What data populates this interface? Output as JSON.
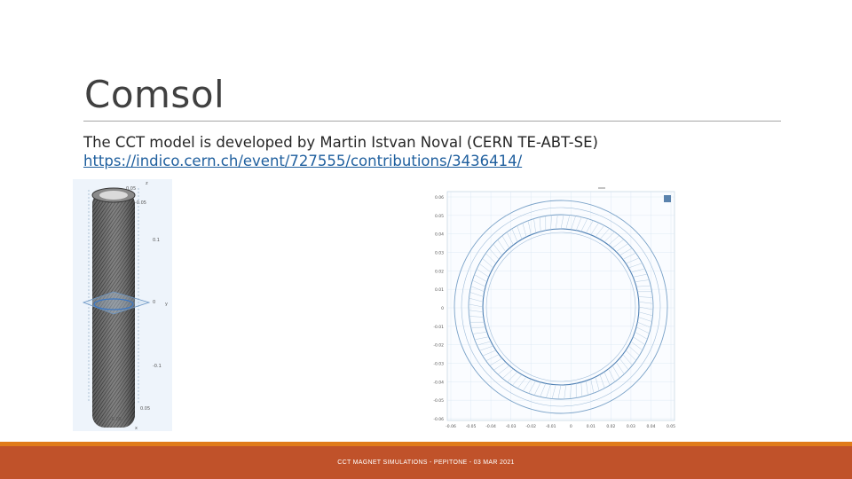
{
  "slide": {
    "title": "Comsol",
    "line1": "The CCT model is developed by Martin Istvan Noval (CERN TE-ABT-SE)",
    "link": "https://indico.cern.ch/event/727555/contributions/3436414/",
    "footer": "CCT MAGNET SIMULATIONS - PEPITONE - 03 MAR 2021"
  },
  "left_figure": {
    "axis_labels": [
      "0.05",
      "-0.05",
      "0.1",
      "0",
      "-0.1",
      "0.05",
      "-0.05",
      "z",
      "y",
      "x"
    ]
  },
  "right_figure": {
    "y_ticks": [
      "0.06",
      "0.05",
      "0.04",
      "0.03",
      "0.02",
      "0.01",
      "0",
      "-0.01",
      "-0.02",
      "-0.03",
      "-0.04",
      "-0.05",
      "-0.06"
    ],
    "x_ticks": [
      "-0.06",
      "-0.05",
      "-0.04",
      "-0.03",
      "-0.02",
      "-0.01",
      "0",
      "0.01",
      "0.02",
      "0.03",
      "0.04",
      "0.05"
    ],
    "colors": {
      "ring": "#7aa2c8",
      "grid": "#d8e6f2"
    }
  }
}
